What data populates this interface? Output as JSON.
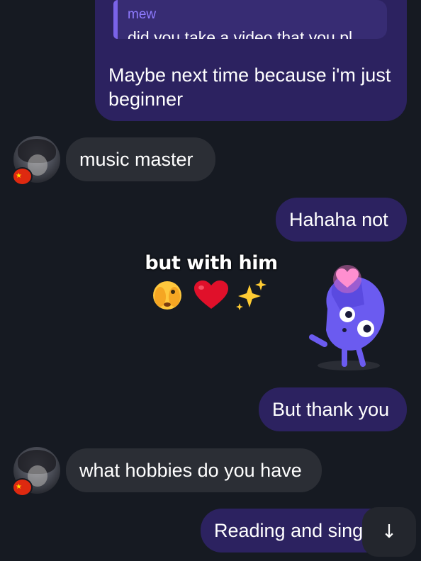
{
  "messages": {
    "reply": {
      "quote_author": "mew",
      "quote_text": "did you take a video that you pl...",
      "text": "Maybe next time because i'm just beginner"
    },
    "incoming_1": {
      "text": "music master"
    },
    "outgoing_1": {
      "text": "Hahaha not"
    },
    "outgoing_2": {
      "text": "But thank you"
    },
    "incoming_2": {
      "text": "what hobbies do you have"
    },
    "outgoing_3": {
      "text": "Reading and sing"
    }
  },
  "overlay": {
    "caption": "but with him",
    "emojis": [
      "face-with-peeking-eye",
      "red-heart",
      "sparkles"
    ]
  },
  "avatar": {
    "flag": "china-flag"
  },
  "scroll_button": {
    "glyph": "↓"
  },
  "colors": {
    "background": "#161a22",
    "outgoing_bubble": "#2c2260",
    "incoming_bubble": "#2b2e35",
    "quote_accent": "#8f7bff",
    "sticker_purple": "#6b5bf0"
  }
}
